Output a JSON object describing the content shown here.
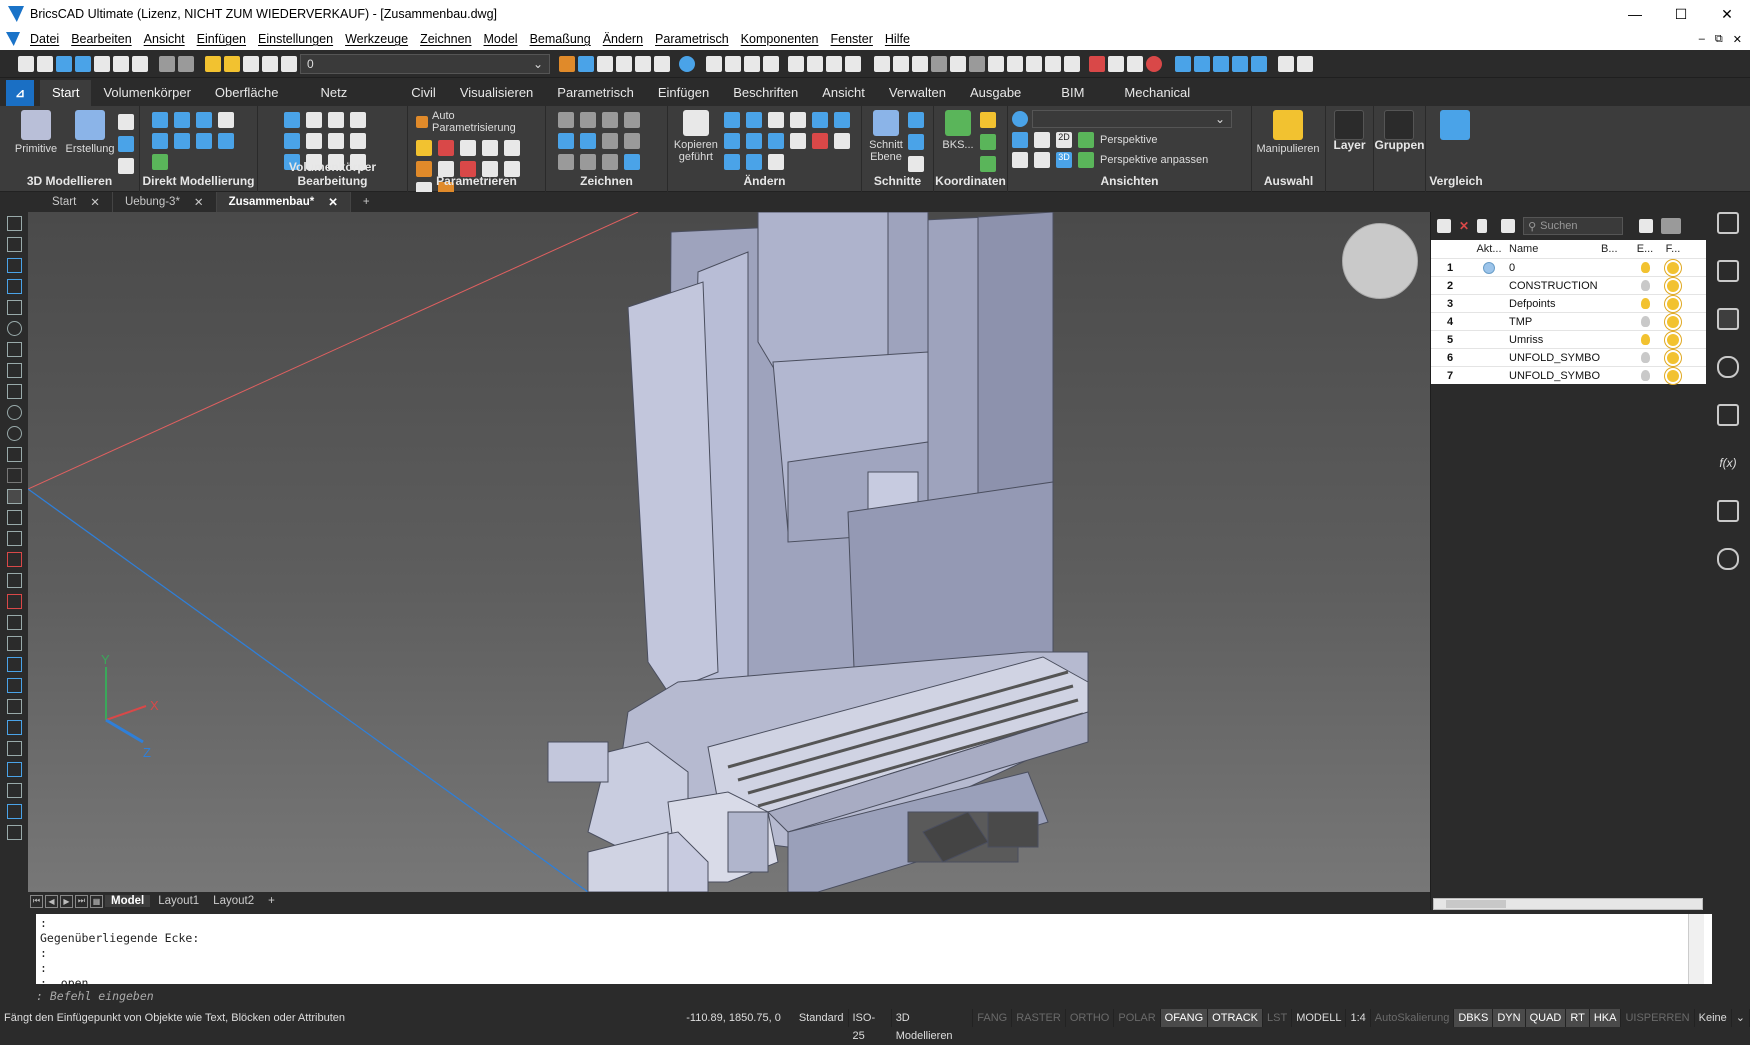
{
  "window": {
    "title": "BricsCAD Ultimate (Lizenz, NICHT ZUM WIEDERVERKAUF) - [Zusammenbau.dwg]",
    "minimize": "—",
    "maximize": "☐",
    "close": "✕"
  },
  "menu": [
    "Datei",
    "Bearbeiten",
    "Ansicht",
    "Einfügen",
    "Einstellungen",
    "Werkzeuge",
    "Zeichnen",
    "Model",
    "Bemaßung",
    "Ändern",
    "Parametrisch",
    "Komponenten",
    "Fenster",
    "Hilfe"
  ],
  "menu_right": [
    "–",
    "⧉",
    "✕"
  ],
  "quick_access": {
    "layer_value": "0"
  },
  "ribbon_tabs": {
    "brand": "⊿",
    "items": [
      "Start",
      "Volumenkörper",
      "Oberfläche",
      "Netz",
      "Civil",
      "Visualisieren",
      "Parametrisch",
      "Einfügen",
      "Beschriften",
      "Ansicht",
      "Verwalten",
      "Ausgabe",
      "BIM",
      "Mechanical"
    ],
    "active": "Start"
  },
  "ribbon": {
    "panels": {
      "model3d": {
        "label": "3D Modellieren",
        "primitive": "Primitive",
        "erstellung": "Erstellung"
      },
      "direct": {
        "label": "Direkt Modellierung"
      },
      "solid_edit": {
        "label": "Volumenkörper Bearbeitung"
      },
      "param": {
        "label": "Parametrieren",
        "auto": "Auto Parametrisierung"
      },
      "draw": {
        "label": "Zeichnen"
      },
      "modify": {
        "label": "Ändern",
        "copy": "Kopieren geführt"
      },
      "sections": {
        "label": "Schnitte",
        "cut": "Schnitt Ebene"
      },
      "coords": {
        "label": "Koordinaten",
        "bks": "BKS..."
      },
      "views": {
        "label": "Ansichten",
        "persp": "Perspektive",
        "persp_fit": "Perspektive anpassen",
        "v2d": "2D",
        "v3d": "3D"
      },
      "select": {
        "label": "Auswahl",
        "manip": "Manipulieren"
      },
      "layer": {
        "label": "Layer"
      },
      "groups": {
        "label": "Gruppen"
      },
      "compare": {
        "label": "Vergleich"
      }
    }
  },
  "doc_tabs": [
    {
      "label": "Start",
      "active": false
    },
    {
      "label": "Uebung-3*",
      "active": false
    },
    {
      "label": "Zusammenbau*",
      "active": true
    }
  ],
  "doc_tab_add": "+",
  "layout_tabs": {
    "items": [
      "Model",
      "Layout1",
      "Layout2"
    ],
    "active": "Model",
    "add": "+"
  },
  "axes": {
    "y": "Y",
    "x": "X",
    "z": "Z"
  },
  "layer_panel": {
    "search_placeholder": "Suchen",
    "headers": {
      "akt": "Akt...",
      "name": "Name",
      "b": "B...",
      "e": "E...",
      "f": "F..."
    },
    "rows": [
      {
        "num": "1",
        "name": "0",
        "active": true,
        "on": true
      },
      {
        "num": "2",
        "name": "CONSTRUCTION",
        "active": false,
        "on": false
      },
      {
        "num": "3",
        "name": "Defpoints",
        "active": false,
        "on": true
      },
      {
        "num": "4",
        "name": "TMP",
        "active": false,
        "on": false
      },
      {
        "num": "5",
        "name": "Umriss",
        "active": false,
        "on": true
      },
      {
        "num": "6",
        "name": "UNFOLD_SYMBOL_DOWN",
        "active": false,
        "on": false
      },
      {
        "num": "7",
        "name": "UNFOLD_SYMBOL_UP",
        "active": false,
        "on": false
      }
    ]
  },
  "command": {
    "history": ":\nGegenüberliegende Ecke:\n:\n:\n: _open",
    "prompt": ": Befehl eingeben"
  },
  "status": {
    "hint": "Fängt den Einfügepunkt von Objekte wie Text, Blöcken oder Attributen",
    "coords": "-110.89, 1850.75, 0",
    "buttons": [
      {
        "label": "Standard",
        "state": "normal"
      },
      {
        "label": "ISO-25",
        "state": "normal"
      },
      {
        "label": "3D Modellieren",
        "state": "normal"
      },
      {
        "label": "FANG",
        "state": "off"
      },
      {
        "label": "RASTER",
        "state": "off"
      },
      {
        "label": "ORTHO",
        "state": "off"
      },
      {
        "label": "POLAR",
        "state": "off"
      },
      {
        "label": "OFANG",
        "state": "on"
      },
      {
        "label": "OTRACK",
        "state": "on"
      },
      {
        "label": "LST",
        "state": "off"
      },
      {
        "label": "MODELL",
        "state": "normal"
      },
      {
        "label": "1:4",
        "state": "normal"
      },
      {
        "label": "AutoSkalierung",
        "state": "off"
      },
      {
        "label": "DBKS",
        "state": "on"
      },
      {
        "label": "DYN",
        "state": "on"
      },
      {
        "label": "QUAD",
        "state": "on"
      },
      {
        "label": "RT",
        "state": "on"
      },
      {
        "label": "HKA",
        "state": "on"
      },
      {
        "label": "UISPERREN",
        "state": "off"
      },
      {
        "label": "Keine",
        "state": "normal"
      }
    ]
  },
  "colors": {
    "accent": "#1a6fc4",
    "ribbon_bg": "#3c3c3c",
    "app_bg": "#2b2b2b",
    "model": "#b9bfd8"
  }
}
